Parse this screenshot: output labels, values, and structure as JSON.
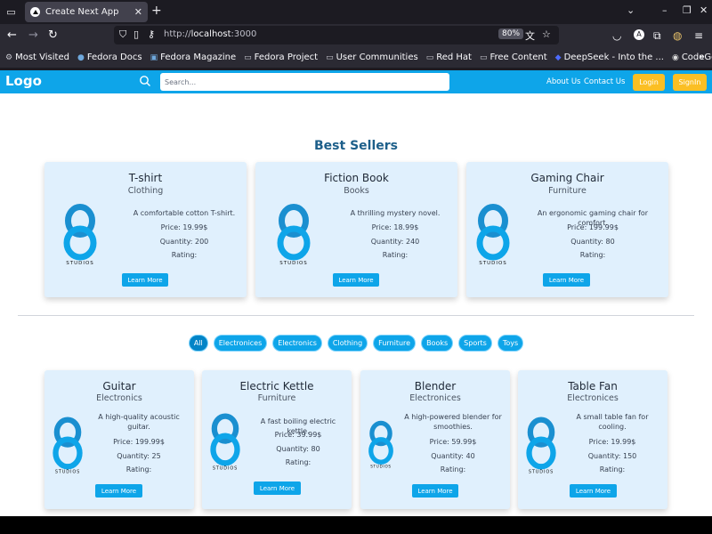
{
  "browser": {
    "tab_title": "Create Next App",
    "url_prefix": "http://",
    "url_host": "localhost",
    "url_port": ":3000",
    "zoom": "80%",
    "bookmarks": [
      {
        "label": "Most Visited",
        "icon": "gear-icon"
      },
      {
        "label": "Fedora Docs",
        "icon": "fedora-icon"
      },
      {
        "label": "Fedora Magazine",
        "icon": "magazine-icon"
      },
      {
        "label": "Fedora Project",
        "icon": "folder-icon"
      },
      {
        "label": "User Communities",
        "icon": "folder-icon"
      },
      {
        "label": "Red Hat",
        "icon": "folder-icon"
      },
      {
        "label": "Free Content",
        "icon": "folder-icon"
      },
      {
        "label": "DeepSeek - Into the ...",
        "icon": "deepseek-icon"
      },
      {
        "label": "CodeGeeX",
        "icon": "codegeex-icon"
      }
    ]
  },
  "header": {
    "logo": "Logo",
    "search_placeholder": "Search...",
    "about": "About Us",
    "contact": "Contact Us",
    "login": "Login",
    "signup": "SignIn"
  },
  "bestsellers_title": "Best Sellers",
  "brand_text": "STUDIOS",
  "bestsellers": [
    {
      "name": "T-shirt",
      "category": "Clothing",
      "desc": "A comfortable cotton T-shirt.",
      "price": "Price: 19.99$",
      "qty": "Quantity: 200",
      "rating": "Rating:",
      "button": "Learn More"
    },
    {
      "name": "Fiction Book",
      "category": "Books",
      "desc": "A thrilling mystery novel.",
      "price": "Price: 18.99$",
      "qty": "Quantity: 240",
      "rating": "Rating:",
      "button": "Learn More"
    },
    {
      "name": "Gaming Chair",
      "category": "Furniture",
      "desc": "An ergonomic gaming chair for comfort.",
      "price": "Price: 199.99$",
      "qty": "Quantity: 80",
      "rating": "Rating:",
      "button": "Learn More"
    }
  ],
  "filters": [
    "All",
    "Electronices",
    "Electronics",
    "Clothing",
    "Furniture",
    "Books",
    "Sports",
    "Toys"
  ],
  "products": [
    {
      "name": "Guitar",
      "category": "Electronics",
      "desc1": "A high-quality acoustic",
      "desc2": "guitar.",
      "price": "Price: 199.99$",
      "qty": "Quantity: 25",
      "rating": "Rating:",
      "button": "Learn More"
    },
    {
      "name": "Electric Kettle",
      "category": "Furniture",
      "desc1": "A fast boiling electric kettle.",
      "desc2": "",
      "price": "Price: 39.99$",
      "qty": "Quantity: 80",
      "rating": "Rating:",
      "button": "Learn More"
    },
    {
      "name": "Blender",
      "category": "Electronices",
      "desc1": "A high-powered blender for",
      "desc2": "smoothies.",
      "price": "Price: 59.99$",
      "qty": "Quantity: 40",
      "rating": "Rating:",
      "button": "Learn More"
    },
    {
      "name": "Table Fan",
      "category": "Electronices",
      "desc1": "A small table fan for",
      "desc2": "cooling.",
      "price": "Price: 19.99$",
      "qty": "Quantity: 150",
      "rating": "Rating:",
      "button": "Learn More"
    }
  ]
}
